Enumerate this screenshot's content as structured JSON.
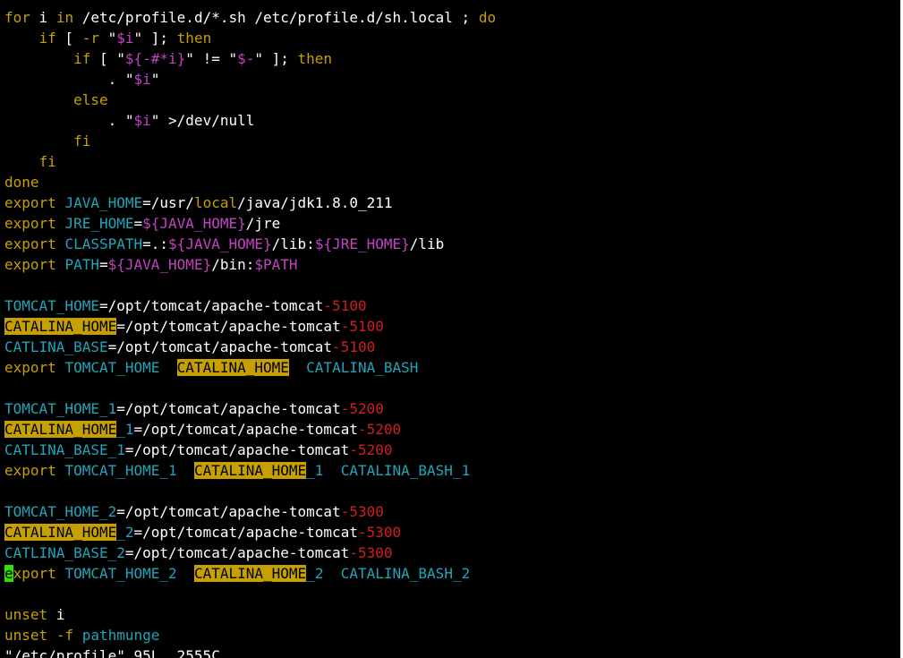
{
  "editor": {
    "lines": [
      [
        [
          "k",
          "for"
        ],
        [
          "w",
          " i "
        ],
        [
          "k",
          "in"
        ],
        [
          "w",
          " /etc/profile.d/*.sh /etc/profile.d/sh.local ; "
        ],
        [
          "k",
          "do"
        ]
      ],
      [
        [
          "w",
          "    "
        ],
        [
          "k",
          "if"
        ],
        [
          "w",
          " [ "
        ],
        [
          "k",
          "-r"
        ],
        [
          "w",
          " \""
        ],
        [
          "m",
          "$i"
        ],
        [
          "w",
          "\" ]; "
        ],
        [
          "k",
          "then"
        ]
      ],
      [
        [
          "w",
          "        "
        ],
        [
          "k",
          "if"
        ],
        [
          "w",
          " [ \""
        ],
        [
          "m",
          "${-#*i}"
        ],
        [
          "w",
          "\" != \""
        ],
        [
          "m",
          "$-"
        ],
        [
          "w",
          "\" ]; "
        ],
        [
          "k",
          "then"
        ]
      ],
      [
        [
          "w",
          "            . \""
        ],
        [
          "m",
          "$i"
        ],
        [
          "w",
          "\""
        ]
      ],
      [
        [
          "w",
          "        "
        ],
        [
          "k",
          "else"
        ]
      ],
      [
        [
          "w",
          "            . \""
        ],
        [
          "m",
          "$i"
        ],
        [
          "w",
          "\" >/dev/null"
        ]
      ],
      [
        [
          "w",
          "        "
        ],
        [
          "k",
          "fi"
        ]
      ],
      [
        [
          "w",
          "    "
        ],
        [
          "k",
          "fi"
        ]
      ],
      [
        [
          "k",
          "done"
        ]
      ],
      [
        [
          "k",
          "export"
        ],
        [
          "w",
          " "
        ],
        [
          "c",
          "JAVA_HOME"
        ],
        [
          "w",
          "=/usr/"
        ],
        [
          "k",
          "local"
        ],
        [
          "w",
          "/java/jdk1.8.0_211"
        ]
      ],
      [
        [
          "k",
          "export"
        ],
        [
          "w",
          " "
        ],
        [
          "c",
          "JRE_HOME"
        ],
        [
          "w",
          "="
        ],
        [
          "m",
          "${JAVA_HOME}"
        ],
        [
          "w",
          "/jre"
        ]
      ],
      [
        [
          "k",
          "export"
        ],
        [
          "w",
          " "
        ],
        [
          "c",
          "CLASSPATH"
        ],
        [
          "w",
          "=.:"
        ],
        [
          "m",
          "${JAVA_HOME}"
        ],
        [
          "w",
          "/lib:"
        ],
        [
          "m",
          "${JRE_HOME}"
        ],
        [
          "w",
          "/lib"
        ]
      ],
      [
        [
          "k",
          "export"
        ],
        [
          "w",
          " "
        ],
        [
          "c",
          "PATH"
        ],
        [
          "w",
          "="
        ],
        [
          "m",
          "${JAVA_HOME}"
        ],
        [
          "w",
          "/bin:"
        ],
        [
          "m",
          "$PATH"
        ]
      ],
      [],
      [
        [
          "c",
          "TOMCAT_HOME"
        ],
        [
          "w",
          "=/opt/tomcat/apache-tomcat"
        ],
        [
          "r",
          "-5100"
        ]
      ],
      [
        [
          "hl",
          "CATALINA_HOME"
        ],
        [
          "w",
          "=/opt/tomcat/apache-tomcat"
        ],
        [
          "r",
          "-5100"
        ]
      ],
      [
        [
          "c",
          "CATLINA_BASE"
        ],
        [
          "w",
          "=/opt/tomcat/apache-tomcat"
        ],
        [
          "r",
          "-5100"
        ]
      ],
      [
        [
          "k",
          "export"
        ],
        [
          "w",
          " "
        ],
        [
          "c",
          "TOMCAT_HOME"
        ],
        [
          "w",
          "  "
        ],
        [
          "hl",
          "CATALINA_HOME"
        ],
        [
          "w",
          "  "
        ],
        [
          "c",
          "CATALINA_BASH"
        ]
      ],
      [],
      [
        [
          "c",
          "TOMCAT_HOME_1"
        ],
        [
          "w",
          "=/opt/tomcat/apache-tomcat"
        ],
        [
          "r",
          "-5200"
        ]
      ],
      [
        [
          "hl",
          "CATALINA_HOME"
        ],
        [
          "c",
          "_1"
        ],
        [
          "w",
          "=/opt/tomcat/apache-tomcat"
        ],
        [
          "r",
          "-5200"
        ]
      ],
      [
        [
          "c",
          "CATLINA_BASE_1"
        ],
        [
          "w",
          "=/opt/tomcat/apache-tomcat"
        ],
        [
          "r",
          "-5200"
        ]
      ],
      [
        [
          "k",
          "export"
        ],
        [
          "w",
          " "
        ],
        [
          "c",
          "TOMCAT_HOME_1"
        ],
        [
          "w",
          "  "
        ],
        [
          "hl",
          "CATALINA_HOME"
        ],
        [
          "c",
          "_1"
        ],
        [
          "w",
          "  "
        ],
        [
          "c",
          "CATALINA_BASH_1"
        ]
      ],
      [],
      [
        [
          "c",
          "TOMCAT_HOME_2"
        ],
        [
          "w",
          "=/opt/tomcat/apache-tomcat"
        ],
        [
          "r",
          "-5300"
        ]
      ],
      [
        [
          "hl",
          "CATALINA_HOME"
        ],
        [
          "c",
          "_2"
        ],
        [
          "w",
          "=/opt/tomcat/apache-tomcat"
        ],
        [
          "r",
          "-5300"
        ]
      ],
      [
        [
          "c",
          "CATLINA_BASE_2"
        ],
        [
          "w",
          "=/opt/tomcat/apache-tomcat"
        ],
        [
          "r",
          "-5300"
        ]
      ],
      [
        [
          "cur",
          "e"
        ],
        [
          "k",
          "xport"
        ],
        [
          "w",
          " "
        ],
        [
          "c",
          "TOMCAT_HOME_2"
        ],
        [
          "w",
          "  "
        ],
        [
          "hl",
          "CATALINA_HOME"
        ],
        [
          "c",
          "_2"
        ],
        [
          "w",
          "  "
        ],
        [
          "c",
          "CATALINA_BASH_2"
        ]
      ],
      [],
      [
        [
          "k",
          "unset"
        ],
        [
          "w",
          " i"
        ]
      ],
      [
        [
          "k",
          "unset"
        ],
        [
          "w",
          " "
        ],
        [
          "k",
          "-f"
        ],
        [
          "w",
          " "
        ],
        [
          "c",
          "pathmunge"
        ]
      ]
    ],
    "status_line": "\"/etc/profile\" 95L, 2555C"
  },
  "colors": {
    "background": "#000000",
    "keyword": "#c5a000",
    "text": "#ffffff",
    "identifier": "#1fa5b8",
    "special": "#c242c2",
    "number": "#d11f1f",
    "search_highlight": "#c5a000",
    "cursor": "#2fe000"
  }
}
